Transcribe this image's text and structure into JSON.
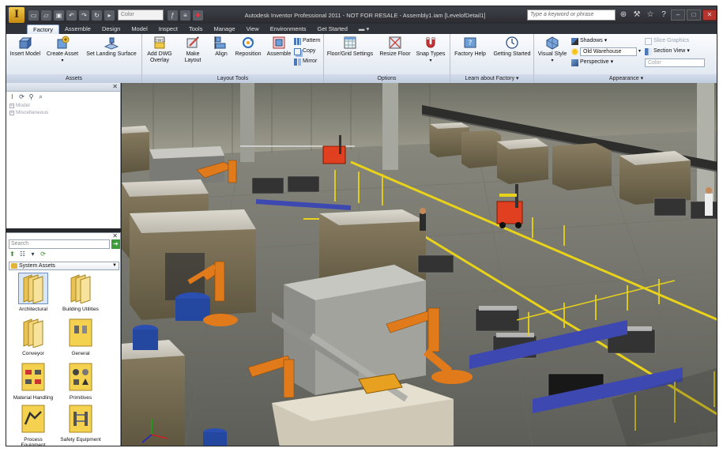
{
  "app": {
    "logo_letter": "I",
    "window_title": "Autodesk Inventor Professional 2011 - NOT FOR RESALE - Assembly1.iam [LevelofDetail1]",
    "color_select": "Color",
    "keyword_search_placeholder": "Type a keyword or phrase"
  },
  "tabs": [
    "Factory",
    "Assemble",
    "Design",
    "Model",
    "Inspect",
    "Tools",
    "Manage",
    "View",
    "Environments",
    "Get Started"
  ],
  "active_tab": "Factory",
  "ribbon": {
    "assets": {
      "title": "Assets",
      "insert_model": "Insert Model",
      "create_asset": "Create Asset",
      "set_landing_surface": "Set Landing Surface"
    },
    "layout_tools": {
      "title": "Layout Tools",
      "add_dwg_overlay": [
        "Add DWG",
        "Overlay"
      ],
      "make_layout": "Make Layout",
      "align": "Align",
      "reposition": "Reposition",
      "assemble": "Assemble",
      "pattern": "Pattern",
      "copy": "Copy",
      "mirror": "Mirror"
    },
    "options": {
      "title": "Options",
      "floor_grid_settings": "Floor/Grid Settings",
      "resize_floor": "Resize Floor",
      "snap_types": "Snap Types"
    },
    "learn": {
      "title": "Learn about Factory",
      "factory_help": "Factory Help",
      "getting_started": "Getting Started"
    },
    "appearance": {
      "title": "Appearance",
      "visual_style": "Visual Style",
      "shadows": "Shadows",
      "old_warehouse": "Old Warehouse",
      "perspective": "Perspective",
      "slice_graphics": "Slice Graphics",
      "section_view": "Section View",
      "color": "Color"
    }
  },
  "browser": {
    "items": [
      "Model",
      "Miscellaneous"
    ]
  },
  "asset_browser": {
    "search_placeholder": "Search",
    "folder": "System Assets",
    "items": [
      {
        "label": "Architectural"
      },
      {
        "label": "Building Utilities"
      },
      {
        "label": "Conveyor"
      },
      {
        "label": "General"
      },
      {
        "label": "Material Handling"
      },
      {
        "label": "Primitives"
      },
      {
        "label": "Process Equipment"
      },
      {
        "label": "Safety Equipment"
      }
    ]
  },
  "colors": {
    "accent_yellow": "#f0c94a",
    "ribbon_blue": "#dde5ef",
    "floor_line_yellow": "#e8d21a",
    "robot_orange": "#e07a1a"
  }
}
